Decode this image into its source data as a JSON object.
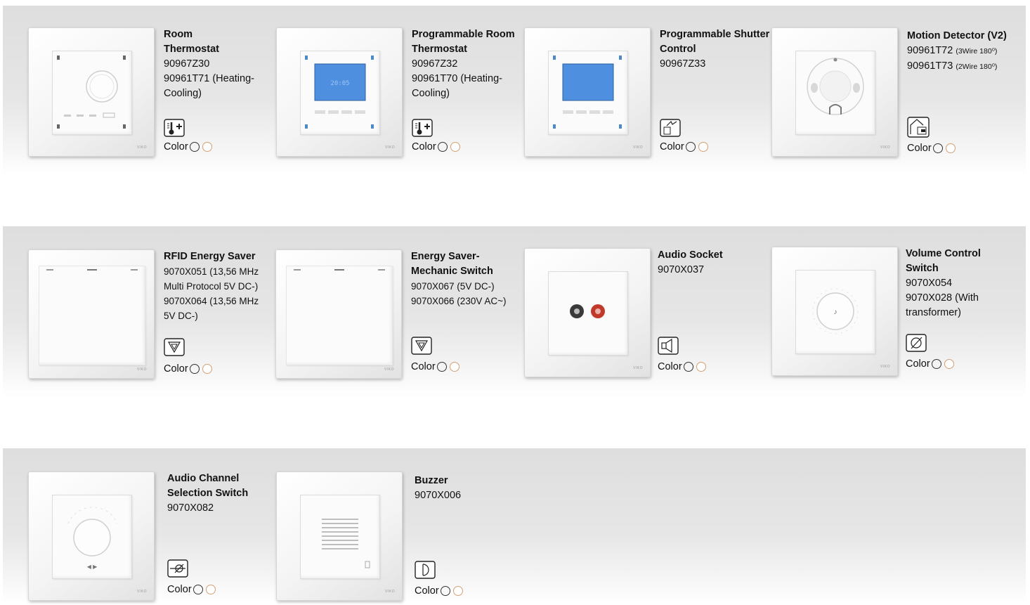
{
  "rows": [
    {
      "products": [
        {
          "title": "Room Thermostat",
          "codes": [
            "90967Z30",
            "90961T71 (Heating-Cooling)"
          ],
          "symbol": "thermometer-plus-icon",
          "color_label": "Color"
        },
        {
          "title": "Programmable Room Thermostat",
          "codes": [
            "90967Z32",
            "90961T70 (Heating-Cooling)"
          ],
          "symbol": "thermometer-plus-icon",
          "color_label": "Color"
        },
        {
          "title": "Programmable Shutter Control",
          "codes": [
            "90967Z33"
          ],
          "symbol": "shutter-control-icon",
          "color_label": "Color"
        },
        {
          "title": "Motion Detector (V2)",
          "codes": [
            "90961T72",
            "90961T73"
          ],
          "code_notes": [
            "(3Wire 180⁰)",
            "(2Wire 180⁰)"
          ],
          "symbol": "motion-detector-icon",
          "color_label": "Color"
        }
      ]
    },
    {
      "products": [
        {
          "title": "RFID Energy Saver",
          "codes": [
            "9070X051 (13,56 MHz Multi Protocol 5V DC-)",
            "9070X064 (13,56 MHz 5V DC-)"
          ],
          "symbol": "card-slot-icon",
          "color_label": "Color"
        },
        {
          "title": "Energy Saver-Mechanic Switch",
          "codes": [
            "9070X067 (5V DC-)",
            "9070X066 (230V AC~)"
          ],
          "symbol": "card-slot-icon",
          "color_label": "Color"
        },
        {
          "title": "Audio Socket",
          "codes": [
            "9070X037"
          ],
          "symbol": "speaker-icon",
          "color_label": "Color"
        },
        {
          "title": "Volume Control Switch",
          "codes": [
            "9070X054",
            "9070X028 (With transformer)"
          ],
          "symbol": "volume-control-icon",
          "color_label": "Color"
        }
      ]
    },
    {
      "products": [
        {
          "title": "Audio Channel Selection Switch",
          "codes": [
            "9070X082"
          ],
          "symbol": "channel-selector-icon",
          "color_label": "Color"
        },
        {
          "title": "Buzzer",
          "codes": [
            "9070X006"
          ],
          "symbol": "buzzer-icon",
          "color_label": "Color"
        }
      ]
    }
  ],
  "brand": "VIKO",
  "colors": {
    "white_swatch": "#ffffff",
    "cream_swatch_border": "#d4a074",
    "band": "#e2e2e2"
  }
}
